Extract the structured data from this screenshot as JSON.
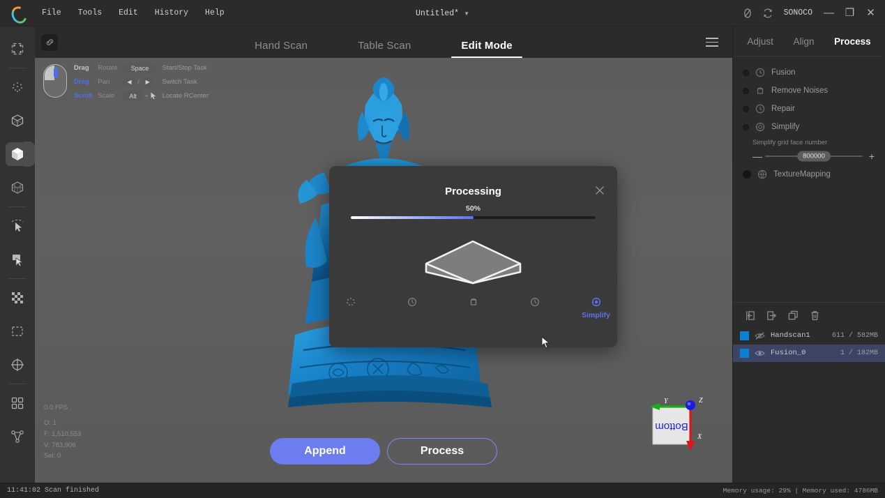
{
  "titlebar": {
    "menus": [
      "File",
      "Tools",
      "Edit",
      "History",
      "Help"
    ],
    "document_title": "Untitled*",
    "caret": "▼",
    "user": "SONOCO",
    "icons": [
      "no-capture-icon",
      "sync-icon"
    ],
    "window_controls": {
      "minimize": "—",
      "maximize": "❐",
      "close": "✕"
    }
  },
  "left_toolbar": {
    "items": [
      {
        "name": "crop-frame-icon",
        "active": false
      },
      {
        "name": "point-cloud-icon",
        "active": false
      },
      {
        "name": "wireframe-cube-icon",
        "active": false
      },
      {
        "name": "solid-cube-icon",
        "active": true
      },
      {
        "name": "mesh-cube-icon",
        "active": false
      },
      {
        "name": "cursor-select-icon",
        "active": false
      },
      {
        "name": "lasso-select-icon",
        "active": false
      },
      {
        "name": "checkerboard-icon",
        "active": false
      },
      {
        "name": "rectangle-select-icon",
        "active": false
      },
      {
        "name": "crosshair-target-icon",
        "active": false
      },
      {
        "name": "grid-squares-icon",
        "active": false
      },
      {
        "name": "nodes-icon",
        "active": false
      }
    ]
  },
  "viewport": {
    "link_button": "link-icon",
    "menu_button": "hamburger-menu-icon",
    "tabs": [
      {
        "label": "Hand Scan",
        "active": false
      },
      {
        "label": "Table Scan",
        "active": false
      },
      {
        "label": "Edit Mode",
        "active": true
      }
    ],
    "hints": [
      {
        "action": "Drag",
        "desc": "Rotate",
        "key": "Space",
        "label": "Start/Stop Task"
      },
      {
        "action": "Drag",
        "desc": "Pan",
        "key": "arrows",
        "label": "Switch Task"
      },
      {
        "action": "Scroll",
        "desc": "Scale",
        "key": "Alt",
        "label": "Locate RCenter"
      }
    ],
    "stats": {
      "fps": "0.0 FPS",
      "objects": "O: 1",
      "faces": "F: 1,510,553",
      "vertices": "V: 783,906",
      "selected": "Sel: 0"
    },
    "gizmo": {
      "face_label": "Bottom",
      "x_axis": "X",
      "y_axis": "Y",
      "z_axis": "Z"
    },
    "actions": [
      {
        "label": "Append",
        "style": "filled"
      },
      {
        "label": "Process",
        "style": "outline"
      }
    ]
  },
  "modal": {
    "title": "Processing",
    "close_icon": "close-icon",
    "progress_percent": "50%",
    "progress_value": 50,
    "steps": [
      {
        "icon": "fusion-icon",
        "label": "",
        "active": false
      },
      {
        "icon": "remove-noises-icon",
        "label": "",
        "active": false
      },
      {
        "icon": "repair-icon",
        "label": "",
        "active": false
      },
      {
        "icon": "simplify-step-icon",
        "label": "",
        "active": false
      },
      {
        "icon": "texture-mapping-icon",
        "label": "Simplify",
        "active": true
      }
    ]
  },
  "right_panel": {
    "tabs": [
      {
        "label": "Adjust",
        "active": false
      },
      {
        "label": "Align",
        "active": false
      },
      {
        "label": "Process",
        "active": true
      }
    ],
    "steps": [
      {
        "label": "Fusion",
        "icon": "fusion-icon",
        "enabled": false
      },
      {
        "label": "Remove Noises",
        "icon": "noise-icon",
        "enabled": false
      },
      {
        "label": "Repair",
        "icon": "repair-icon",
        "enabled": false
      },
      {
        "label": "Simplify",
        "icon": "simplify-icon",
        "enabled": false
      },
      {
        "label": "TextureMapping",
        "icon": "texture-icon",
        "enabled": true
      }
    ],
    "slider": {
      "title": "Simplify grid face number",
      "value": "800000",
      "minus": "—",
      "plus": "+"
    },
    "file_toolbar": [
      "import-icon",
      "export-icon",
      "duplicate-icon",
      "delete-icon"
    ],
    "files": [
      {
        "name": "Handscan1",
        "size": "611 / 582MB",
        "visible": false,
        "selected": false
      },
      {
        "name": "Fusion_0",
        "size": "1 / 182MB",
        "visible": true,
        "selected": true
      }
    ]
  },
  "statusbar": {
    "message": "11:41:02 Scan finished",
    "memory": "Memory usage: 29% | Memory used: 4786MB"
  },
  "colors": {
    "accent_blue": "#6d7df0",
    "model_blue": "#1f8fd6",
    "panel_bg": "#2b2b2b",
    "selected_row": "#3c4566"
  }
}
